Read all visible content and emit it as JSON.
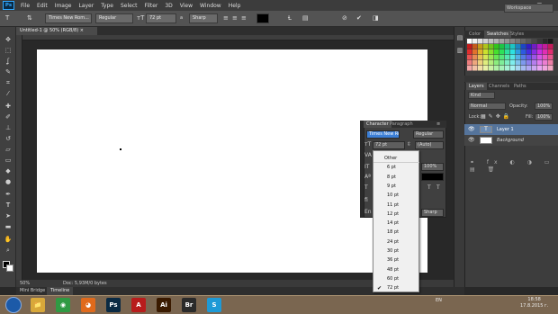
{
  "app": {
    "logo": "Ps"
  },
  "menu": [
    "File",
    "Edit",
    "Image",
    "Layer",
    "Type",
    "Select",
    "Filter",
    "3D",
    "View",
    "Window",
    "Help"
  ],
  "window_controls": {
    "minimize": "—",
    "restore": "❐",
    "close": "✕"
  },
  "options_bar": {
    "font_family": "Times New Rom...",
    "font_style": "Regular",
    "font_size": "72 pt",
    "aa_label": "a",
    "antialias": "Sharp",
    "text_color": "#000000",
    "workspace": "Workspace"
  },
  "document": {
    "tab_title": "Untitled-1 @ 50% (RGB/8) ×",
    "zoom": "50%",
    "doc_info": "Doc: 5,93M/0 bytes"
  },
  "bottom_tabs": [
    "Mini Bridge",
    "Timeline"
  ],
  "right_panel": {
    "swatch_tabs": [
      "Color",
      "Swatches",
      "Styles"
    ],
    "layers_tabs": [
      "Layers",
      "Channels",
      "Paths"
    ],
    "filter_kind": "Kind",
    "blend_mode": "Normal",
    "opacity_label": "Opacity:",
    "opacity_value": "100%",
    "lock_label": "Lock:",
    "fill_label": "Fill:",
    "fill_value": "100%",
    "layers": [
      {
        "name": "Layer 1",
        "thumb": "T",
        "selected": true
      },
      {
        "name": "Background",
        "thumb": "",
        "selected": false
      }
    ],
    "footer_icons": "⚭ fx ◐ ◑ ▭ ▤ 🗑"
  },
  "character_panel": {
    "tabs": [
      "Character",
      "Paragraph"
    ],
    "font_family": "Times New Ro...",
    "font_style": "Regular",
    "size": "72 pt",
    "leading": "(Auto)",
    "scale_value": "100%",
    "antialias": "Sharp",
    "lang_label": "En"
  },
  "size_dropdown": {
    "items": [
      "Other",
      "6 pt",
      "8 pt",
      "9 pt",
      "10 pt",
      "11 pt",
      "12 pt",
      "14 pt",
      "18 pt",
      "24 pt",
      "30 pt",
      "36 pt",
      "48 pt",
      "60 pt",
      "72 pt"
    ],
    "selected": "72 pt",
    "check": "✔"
  },
  "taskbar": {
    "apps": [
      {
        "name": "explorer-folder",
        "label": "📁",
        "color": "#d8a83a"
      },
      {
        "name": "chrome",
        "label": "◉",
        "color": "#2f9a43"
      },
      {
        "name": "firefox",
        "label": "◕",
        "color": "#e06a1c"
      },
      {
        "name": "photoshop",
        "label": "Ps",
        "color": "#0a2a43"
      },
      {
        "name": "acrobat",
        "label": "A",
        "color": "#b81c1c"
      },
      {
        "name": "illustrator",
        "label": "Ai",
        "color": "#3a1a00"
      },
      {
        "name": "bridge",
        "label": "Br",
        "color": "#2a2a2a"
      },
      {
        "name": "skype",
        "label": "S",
        "color": "#1e9ad6"
      }
    ],
    "lang": "EN",
    "time": "18:58",
    "date": "17.8.2015 г."
  },
  "colors": {
    "panel_bg": "#3d3d3d",
    "selected_layer": "#55749b",
    "canvas": "#ffffff"
  }
}
